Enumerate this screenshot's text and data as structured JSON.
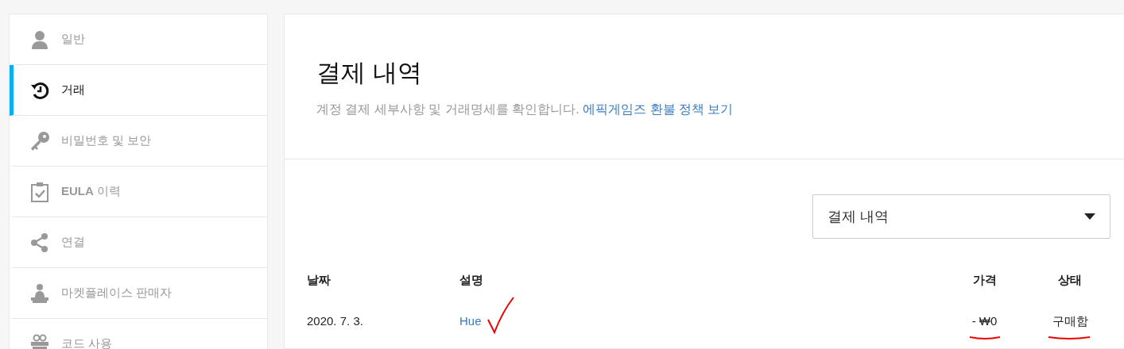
{
  "sidebar": {
    "items": [
      {
        "label": "일반",
        "selected": false
      },
      {
        "label": "거래",
        "selected": true
      },
      {
        "label": "비밀번호 및 보안",
        "selected": false
      },
      {
        "label": "**EULA** 이력",
        "selected": false
      },
      {
        "label": "연결",
        "selected": false
      },
      {
        "label": "마켓플레이스 판매자",
        "selected": false
      },
      {
        "label": "코드 사용",
        "selected": false
      }
    ]
  },
  "header": {
    "title": "결제 내역",
    "description": "계정 결제 세부사항 및 거래명세를 확인합니다.",
    "link": "에픽게임즈 환불 정책 보기"
  },
  "filter": {
    "value": "결제 내역"
  },
  "table": {
    "columns": [
      "날짜",
      "설명",
      "가격",
      "상태"
    ],
    "rows": [
      {
        "date": "2020. 7. 3.",
        "description": "Hue",
        "price": "- ₩0",
        "status": "구매함"
      }
    ]
  }
}
